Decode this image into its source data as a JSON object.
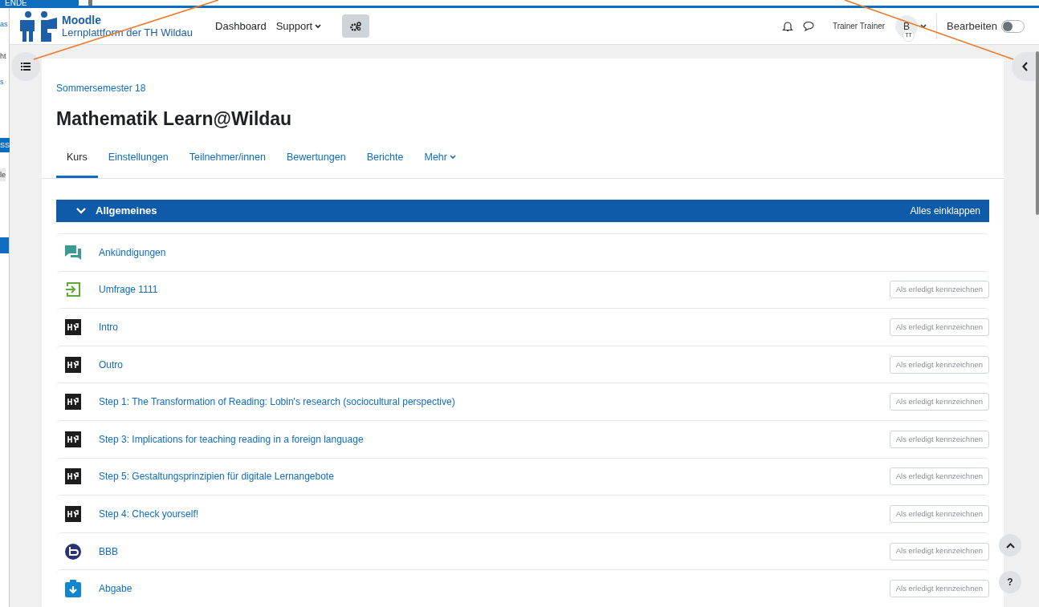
{
  "background_window": {
    "tab": "ENDE",
    "fragments": [
      "as",
      "ht",
      "s",
      "SS",
      "le"
    ]
  },
  "navbar": {
    "brand_title": "Moodle",
    "brand_subtitle": "Lernplattform der TH Wildau",
    "links": [
      {
        "label": "Dashboard",
        "dropdown": false
      },
      {
        "label": "Support",
        "dropdown": true
      }
    ],
    "user_name": "Trainer Trainer",
    "avatar_text": "B",
    "avatar_badge": "TT",
    "edit_label": "Bearbeiten",
    "edit_on": false
  },
  "course": {
    "category": "Sommersemester 18",
    "title": "Mathematik Learn@Wildau",
    "tabs": [
      {
        "label": "Kurs",
        "selected": true,
        "dropdown": false
      },
      {
        "label": "Einstellungen",
        "selected": false,
        "dropdown": false
      },
      {
        "label": "Teilnehmer/innen",
        "selected": false,
        "dropdown": false
      },
      {
        "label": "Bewertungen",
        "selected": false,
        "dropdown": false
      },
      {
        "label": "Berichte",
        "selected": false,
        "dropdown": false
      },
      {
        "label": "Mehr",
        "selected": false,
        "dropdown": true
      }
    ],
    "section": {
      "title": "Allgemeines",
      "expanded": true,
      "collapse_all": "Alles einklappen"
    },
    "activities": [
      {
        "kind": "forum",
        "name": "Ankündigungen"
      },
      {
        "kind": "feedback",
        "name": "Umfrage 1111",
        "button": "Als erledigt kennzeichnen"
      },
      {
        "kind": "h5p",
        "name": "Intro",
        "button": "Als erledigt kennzeichnen"
      },
      {
        "kind": "h5p",
        "name": "Outro",
        "button": "Als erledigt kennzeichnen"
      },
      {
        "kind": "h5p",
        "name": "Step 1: The Transformation of Reading: Lobin's research (sociocultural perspective)",
        "button": "Als erledigt kennzeichnen"
      },
      {
        "kind": "h5p",
        "name": "Step 3: Implications for teaching reading in a foreign language",
        "button": "Als erledigt kennzeichnen"
      },
      {
        "kind": "h5p",
        "name": "Step 5: Gestaltungsprinzipien für digitale Lernangebote",
        "button": "Als erledigt kennzeichnen"
      },
      {
        "kind": "h5p",
        "name": "Step 4: Check yourself!",
        "button": "Als erledigt kennzeichnen"
      },
      {
        "kind": "bbb",
        "name": "BBB",
        "button": "Als erledigt kennzeichnen"
      },
      {
        "kind": "assign",
        "name": "Abgabe",
        "button": "Als erledigt kennzeichnen"
      }
    ]
  },
  "help_button": "?"
}
